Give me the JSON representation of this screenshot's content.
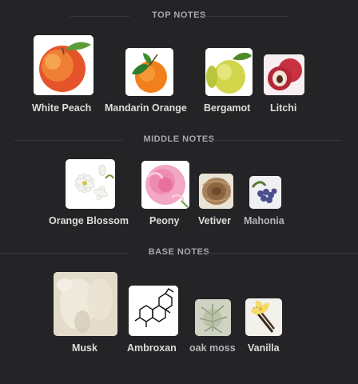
{
  "sections": [
    {
      "title": "TOP NOTES",
      "notes": [
        {
          "name": "White Peach",
          "icon": "white-peach-icon"
        },
        {
          "name": "Mandarin Orange",
          "icon": "mandarin-orange-icon"
        },
        {
          "name": "Bergamot",
          "icon": "bergamot-icon"
        },
        {
          "name": "Litchi",
          "icon": "litchi-icon"
        }
      ]
    },
    {
      "title": "MIDDLE NOTES",
      "notes": [
        {
          "name": "Orange Blossom",
          "icon": "orange-blossom-icon"
        },
        {
          "name": "Peony",
          "icon": "peony-icon"
        },
        {
          "name": "Vetiver",
          "icon": "vetiver-icon"
        },
        {
          "name": "Mahonia",
          "icon": "mahonia-icon"
        }
      ]
    },
    {
      "title": "BASE NOTES",
      "notes": [
        {
          "name": "Musk",
          "icon": "musk-icon"
        },
        {
          "name": "Ambroxan",
          "icon": "ambroxan-icon"
        },
        {
          "name": "oak moss",
          "icon": "oak-moss-icon"
        },
        {
          "name": "Vanilla",
          "icon": "vanilla-icon"
        }
      ]
    }
  ],
  "colors": {
    "background": "#242326",
    "divider": "#3a393d"
  }
}
